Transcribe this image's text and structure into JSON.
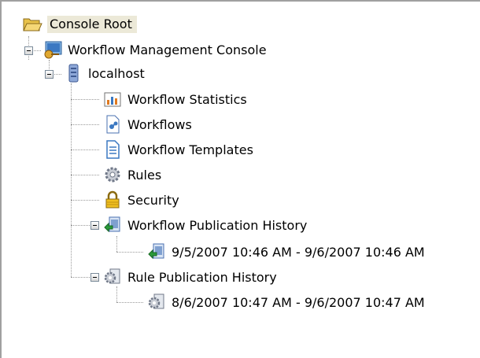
{
  "tree": {
    "root": {
      "label": "Console Root",
      "icon": "folder-open-icon"
    },
    "console": {
      "label": "Workflow Management Console",
      "icon": "console-icon"
    },
    "host": {
      "label": "localhost",
      "icon": "server-icon"
    },
    "items": [
      {
        "label": "Workflow Statistics",
        "icon": "chart-icon"
      },
      {
        "label": "Workflows",
        "icon": "workflow-document-icon"
      },
      {
        "label": "Workflow Templates",
        "icon": "template-document-icon"
      },
      {
        "label": "Rules",
        "icon": "gear-icon"
      },
      {
        "label": "Security",
        "icon": "lock-icon"
      },
      {
        "label": "Workflow Publication History",
        "icon": "publication-icon"
      },
      {
        "label": "9/5/2007 10:46 AM - 9/6/2007 10:46 AM",
        "icon": "publication-entry-icon"
      },
      {
        "label": "Rule Publication History",
        "icon": "rule-history-icon"
      },
      {
        "label": "8/6/2007 10:47 AM - 9/6/2007 10:47 AM",
        "icon": "rule-entry-icon"
      }
    ]
  }
}
